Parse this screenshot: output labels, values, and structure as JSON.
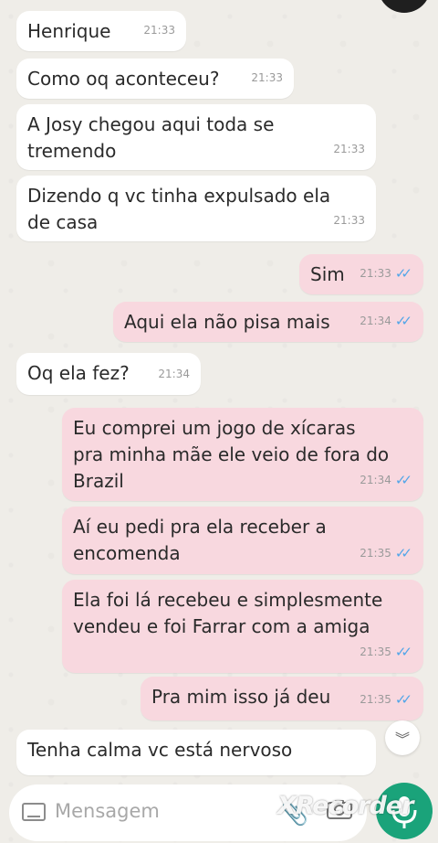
{
  "messages": [
    {
      "text": "Henrique",
      "time": "21:33",
      "dir": "in"
    },
    {
      "text": "Como oq aconteceu?",
      "time": "21:33",
      "dir": "in"
    },
    {
      "text": "A Josy chegou aqui toda se\ntremendo",
      "time": "21:33",
      "dir": "in"
    },
    {
      "text": "Dizendo q vc tinha expulsado ela\nde casa",
      "time": "21:33",
      "dir": "in"
    },
    {
      "text": "Sim",
      "time": "21:33",
      "dir": "out"
    },
    {
      "text": "Aqui ela não pisa mais",
      "time": "21:34",
      "dir": "out"
    },
    {
      "text": "Oq ela fez?",
      "time": "21:34",
      "dir": "in"
    },
    {
      "text": "Eu comprei um jogo de xícaras\npra minha mãe ele veio de fora do\nBrazil",
      "time": "21:34",
      "dir": "out"
    },
    {
      "text": "Aí eu pedi pra ela receber a\nencomenda",
      "time": "21:35",
      "dir": "out"
    },
    {
      "text": "Ela foi lá recebeu e simplesmente\nvendeu e foi Farrar com a amiga",
      "time": "21:35",
      "dir": "out"
    },
    {
      "text": "Pra mim isso já deu",
      "time": "21:35",
      "dir": "out"
    },
    {
      "text": "Tenha calma vc está nervoso",
      "time": "",
      "dir": "in"
    }
  ],
  "composer": {
    "placeholder": "Mensagem",
    "icons": [
      "keyboard-icon",
      "paperclip-icon",
      "camera-icon",
      "mic-icon"
    ]
  },
  "watermark": "XRecorder",
  "colors": {
    "outgoing_bubble": "#f8d8df",
    "incoming_bubble": "#ffffff",
    "read_ticks": "#53a6e8",
    "send_button": "#1aa37a"
  }
}
